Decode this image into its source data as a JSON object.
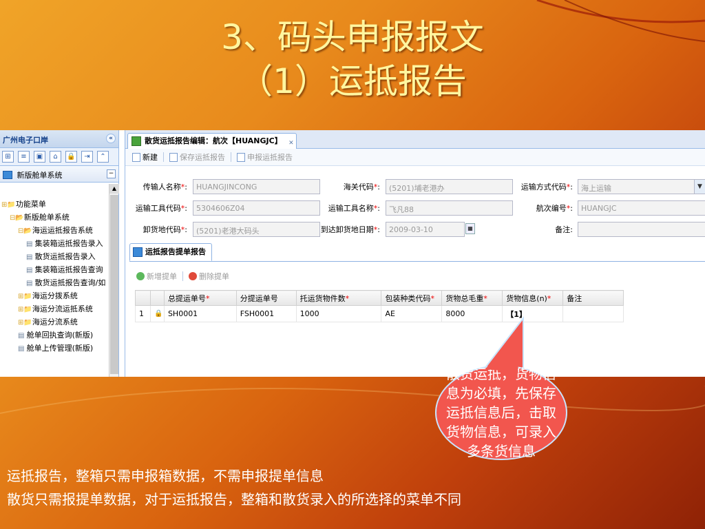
{
  "slide": {
    "title_line1": "3、码头申报报文",
    "title_line2": "（1）运抵报告",
    "callout": "散货运抵，货物信息为必填，先保存运抵信息后，击取货物信息，可录入多条货信息",
    "notes": [
      "运抵报告，整箱只需申报箱数据，不需申报提单信息",
      "散货只需报提单数据，对于运抵报告，整箱和散货录入的所选择的菜单不同"
    ]
  },
  "left_panel": {
    "title": "广州电子口岸",
    "collapse_icon": "«",
    "section_title": "新版舱单系统",
    "tree": [
      {
        "label": "功能菜单",
        "indent": 0,
        "icon": "folder-icon"
      },
      {
        "label": "新版舱单系统",
        "indent": 1,
        "icon": "folder-open-icon"
      },
      {
        "label": "海运运抵报告系统",
        "indent": 2,
        "icon": "folder-open-icon"
      },
      {
        "label": "集装箱运抵报告录入",
        "indent": 3,
        "icon": "page-icon"
      },
      {
        "label": "散货运抵报告录入",
        "indent": 3,
        "icon": "page-icon"
      },
      {
        "label": "集装箱运抵报告查询",
        "indent": 3,
        "icon": "page-icon"
      },
      {
        "label": "散货运抵报告查询/如",
        "indent": 3,
        "icon": "page-icon"
      },
      {
        "label": "海运分拨系统",
        "indent": 2,
        "icon": "folder-icon"
      },
      {
        "label": "海运分流运抵系统",
        "indent": 2,
        "icon": "folder-icon"
      },
      {
        "label": "海运分流系统",
        "indent": 2,
        "icon": "folder-icon"
      },
      {
        "label": "舱单回执查询(新版)",
        "indent": 2,
        "icon": "page-icon"
      },
      {
        "label": "舱单上传管理(新版)",
        "indent": 2,
        "icon": "page-icon"
      }
    ]
  },
  "main": {
    "tab_label": "散货运抵报告编辑：航次【HUANGJC】",
    "toolbar": {
      "new": "新建",
      "save": "保存运抵报告",
      "submit": "申报运抵报告"
    },
    "form": {
      "transmitter_name": {
        "label": "传输人名称",
        "value": "HUANGJINCONG"
      },
      "customs_code": {
        "label": "海关代码",
        "value": "(5201)埔老港办"
      },
      "transport_mode": {
        "label": "运输方式代码",
        "value": "海上运输"
      },
      "vessel_code": {
        "label": "运输工具代码",
        "value": "5304606Z04"
      },
      "vessel_name": {
        "label": "运输工具名称",
        "value": "飞凡88"
      },
      "voyage_no": {
        "label": "航次编号",
        "value": "HUANGJC"
      },
      "unload_place": {
        "label": "卸货地代码",
        "value": "(5201)老港大码头"
      },
      "arrival_date": {
        "label": "到达卸货地日期",
        "value": "2009-03-10"
      },
      "remark": {
        "label": "备注",
        "value": ""
      }
    },
    "subtab_label": "运抵报告提单报告",
    "grid_tools": {
      "add": "新增提单",
      "delete": "删除提单"
    },
    "grid": {
      "columns": [
        "",
        "",
        "总提运单号",
        "分提运单号",
        "托运货物件数",
        "包装种类代码",
        "货物总毛重",
        "货物信息(n)",
        "备注"
      ],
      "required": [
        false,
        false,
        true,
        false,
        true,
        true,
        true,
        true,
        false
      ],
      "rows": [
        [
          "1",
          "",
          "SH0001",
          "FSH0001",
          "1000",
          "AE",
          "8000",
          "【1】",
          ""
        ]
      ]
    }
  }
}
